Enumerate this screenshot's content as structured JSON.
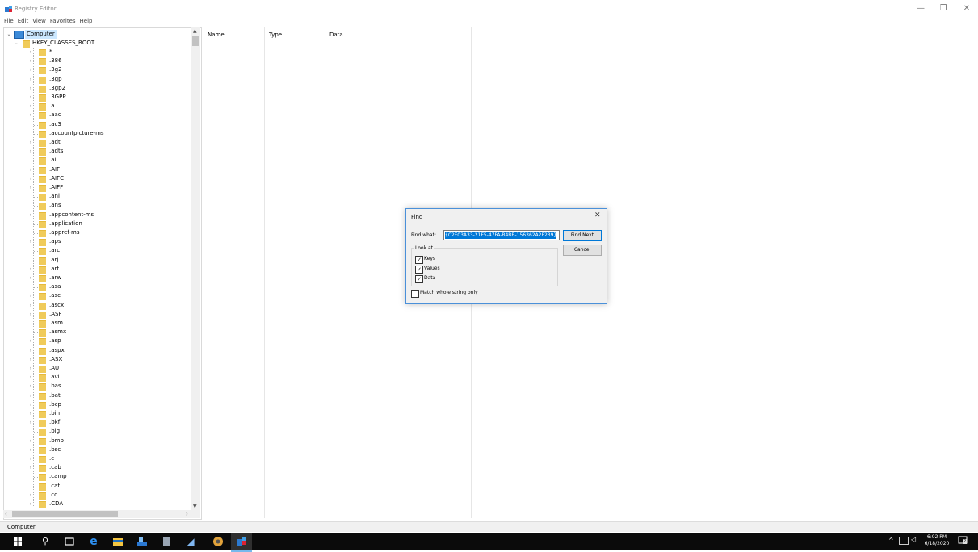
{
  "window": {
    "title": "Registry Editor",
    "controls": {
      "minimize": "—",
      "maximize": "❐",
      "close": "✕"
    }
  },
  "menu": [
    "File",
    "Edit",
    "View",
    "Favorites",
    "Help"
  ],
  "tree": {
    "root": "Computer",
    "hive": "HKEY_CLASSES_ROOT",
    "keys": [
      {
        "label": "*",
        "expandable": true
      },
      {
        "label": ".386",
        "expandable": true
      },
      {
        "label": ".3g2",
        "expandable": true
      },
      {
        "label": ".3gp",
        "expandable": true
      },
      {
        "label": ".3gp2",
        "expandable": true
      },
      {
        "label": ".3GPP",
        "expandable": true
      },
      {
        "label": ".a",
        "expandable": true
      },
      {
        "label": ".aac",
        "expandable": true
      },
      {
        "label": ".ac3",
        "expandable": false
      },
      {
        "label": ".accountpicture-ms",
        "expandable": false
      },
      {
        "label": ".adt",
        "expandable": true
      },
      {
        "label": ".adts",
        "expandable": true
      },
      {
        "label": ".ai",
        "expandable": false
      },
      {
        "label": ".AIF",
        "expandable": true
      },
      {
        "label": ".AIFC",
        "expandable": true
      },
      {
        "label": ".AIFF",
        "expandable": true
      },
      {
        "label": ".ani",
        "expandable": false
      },
      {
        "label": ".ans",
        "expandable": false
      },
      {
        "label": ".appcontent-ms",
        "expandable": true
      },
      {
        "label": ".application",
        "expandable": false
      },
      {
        "label": ".appref-ms",
        "expandable": false
      },
      {
        "label": ".aps",
        "expandable": true
      },
      {
        "label": ".arc",
        "expandable": false
      },
      {
        "label": ".arj",
        "expandable": false
      },
      {
        "label": ".art",
        "expandable": true
      },
      {
        "label": ".arw",
        "expandable": true
      },
      {
        "label": ".asa",
        "expandable": false
      },
      {
        "label": ".asc",
        "expandable": true
      },
      {
        "label": ".ascx",
        "expandable": true
      },
      {
        "label": ".ASF",
        "expandable": true
      },
      {
        "label": ".asm",
        "expandable": false
      },
      {
        "label": ".asmx",
        "expandable": false
      },
      {
        "label": ".asp",
        "expandable": true
      },
      {
        "label": ".aspx",
        "expandable": true
      },
      {
        "label": ".ASX",
        "expandable": true
      },
      {
        "label": ".AU",
        "expandable": true
      },
      {
        "label": ".avi",
        "expandable": true
      },
      {
        "label": ".bas",
        "expandable": true
      },
      {
        "label": ".bat",
        "expandable": true
      },
      {
        "label": ".bcp",
        "expandable": true
      },
      {
        "label": ".bin",
        "expandable": true
      },
      {
        "label": ".bkf",
        "expandable": true
      },
      {
        "label": ".blg",
        "expandable": false
      },
      {
        "label": ".bmp",
        "expandable": true
      },
      {
        "label": ".bsc",
        "expandable": true
      },
      {
        "label": ".c",
        "expandable": true
      },
      {
        "label": ".cab",
        "expandable": true
      },
      {
        "label": ".camp",
        "expandable": false
      },
      {
        "label": ".cat",
        "expandable": false
      },
      {
        "label": ".cc",
        "expandable": true
      },
      {
        "label": ".CDA",
        "expandable": true
      }
    ]
  },
  "list": {
    "columns": [
      "Name",
      "Type",
      "Data"
    ]
  },
  "status": "Computer",
  "find_dialog": {
    "title": "Find",
    "find_what_label": "Find what:",
    "find_what_value": "{C2F03A33-21F5-47FA-B4BB-156362A2F239}",
    "find_next": "Find Next",
    "cancel": "Cancel",
    "look_at": "Look at",
    "keys": "Keys",
    "values": "Values",
    "data": "Data",
    "match_whole": "Match whole string only",
    "checks": {
      "keys": true,
      "values": true,
      "data": true,
      "match_whole": false
    }
  },
  "taskbar": {
    "time": "6:02 PM",
    "date": "6/18/2020",
    "notifications": "2"
  }
}
